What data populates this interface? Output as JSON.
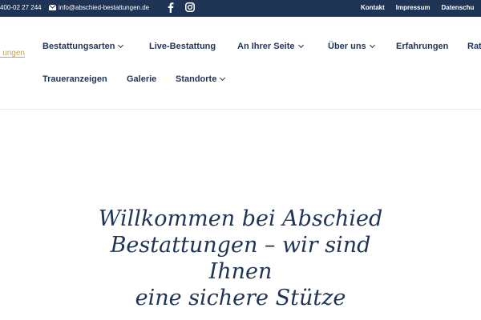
{
  "topbar": {
    "phone": "400-02 27 244",
    "email": "info@abschied-bestattungen.de",
    "links": [
      "Kontakt",
      "Impressum",
      "Datenschu"
    ]
  },
  "logo": {
    "fragment": "ungen"
  },
  "nav": {
    "items": [
      {
        "label": "Bestattungsarten"
      },
      {
        "label": "Live-Bestattung"
      },
      {
        "label": "An Ihrer Seite"
      },
      {
        "label": "Über uns"
      },
      {
        "label": "Erfahrungen"
      },
      {
        "label": "Rat"
      },
      {
        "label": "Traueranzeigen"
      },
      {
        "label": "Galerie"
      },
      {
        "label": "Standorte"
      }
    ]
  },
  "hero": {
    "line1": "Willkommen bei Abschied",
    "line2": "Bestattungen – wir sind Ihnen",
    "line3": "eine sichere Stütze"
  },
  "colors": {
    "brand": "#1f3455",
    "accent": "#c9a24b"
  }
}
